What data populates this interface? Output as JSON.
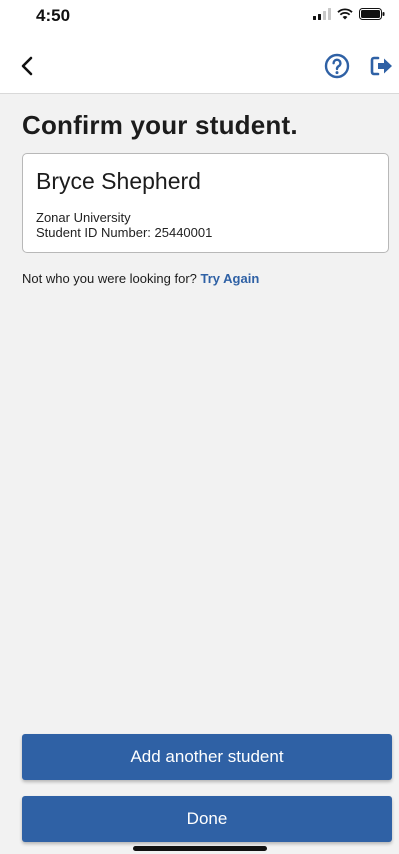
{
  "status_bar": {
    "time": "4:50"
  },
  "nav": {
    "back_icon": "chevron-left-icon",
    "help_icon": "question-circle-icon",
    "logout_icon": "sign-out-icon"
  },
  "page": {
    "title": "Confirm your student."
  },
  "student": {
    "name": "Bryce Shepherd",
    "school": "Zonar University",
    "id_label": "Student ID Number:",
    "id_number": "25440001"
  },
  "not_found": {
    "prompt": "Not who you were looking for?",
    "link": "Try Again"
  },
  "actions": {
    "add_label": "Add another student",
    "done_label": "Done"
  },
  "colors": {
    "accent": "#2f61a5",
    "background": "#f2f2f2"
  }
}
